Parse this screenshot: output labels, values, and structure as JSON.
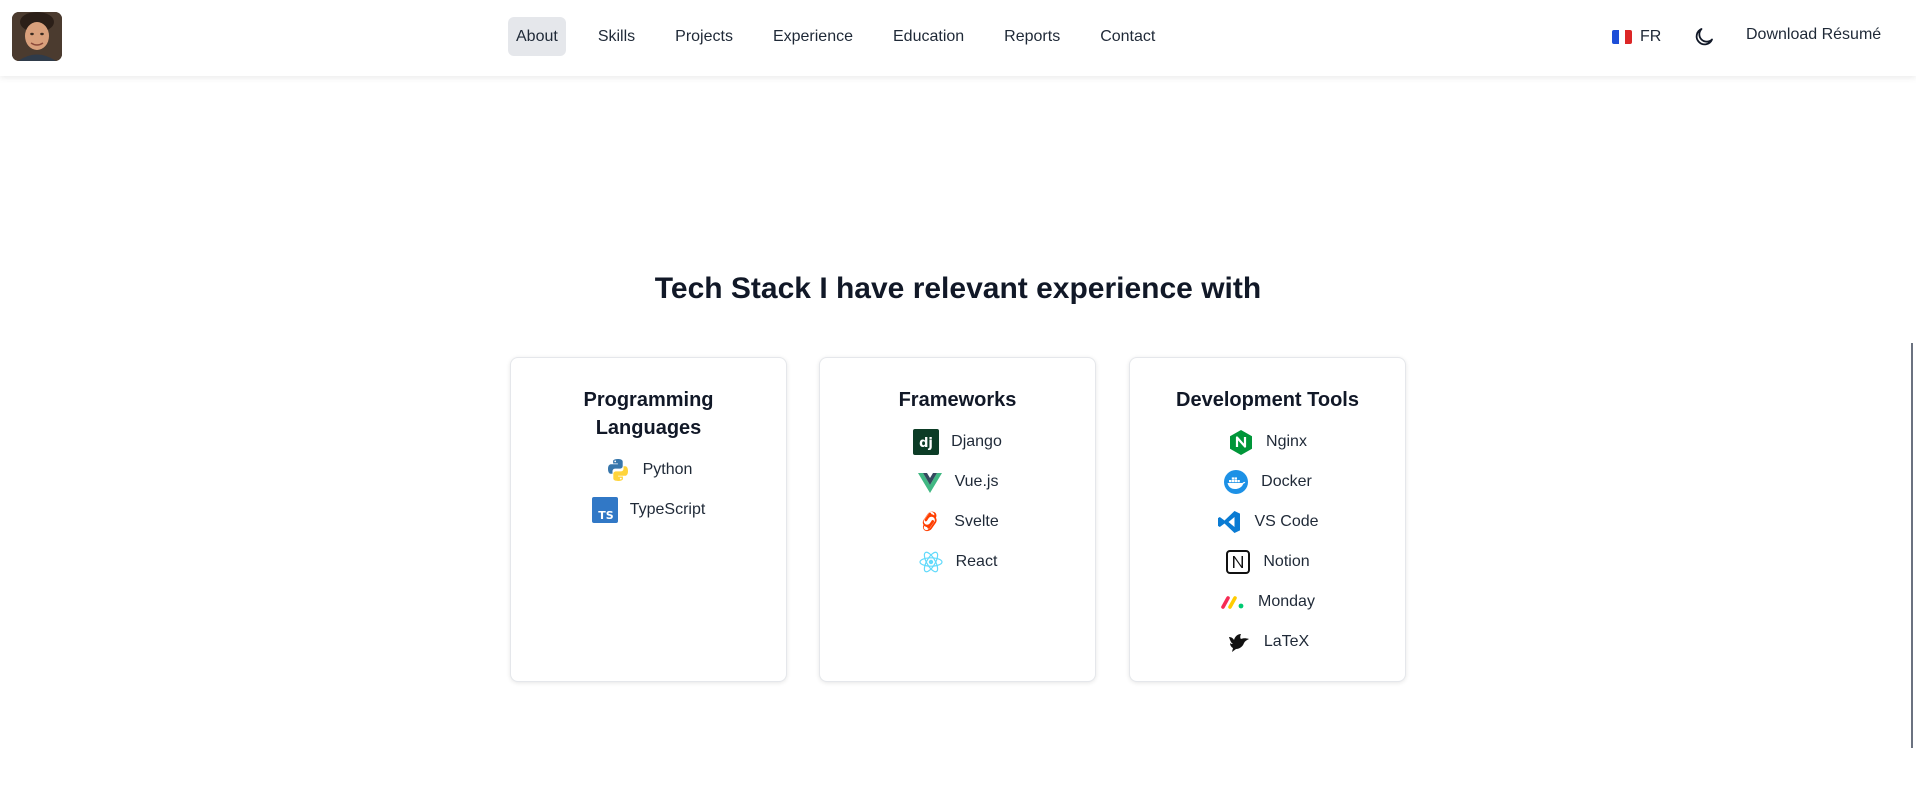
{
  "header": {
    "nav": [
      {
        "label": "About",
        "active": true
      },
      {
        "label": "Skills",
        "active": false
      },
      {
        "label": "Projects",
        "active": false
      },
      {
        "label": "Experience",
        "active": false
      },
      {
        "label": "Education",
        "active": false
      },
      {
        "label": "Reports",
        "active": false
      },
      {
        "label": "Contact",
        "active": false
      }
    ],
    "language": {
      "label": "FR",
      "icon": "france-flag-icon"
    },
    "theme_icon": "moon-icon",
    "download_label": "Download Résumé"
  },
  "section": {
    "title": "Tech Stack I have relevant experience with",
    "cards": [
      {
        "title": "Programming Languages",
        "items": [
          {
            "label": "Python",
            "icon": "python-icon"
          },
          {
            "label": "TypeScript",
            "icon": "typescript-icon"
          }
        ]
      },
      {
        "title": "Frameworks",
        "items": [
          {
            "label": "Django",
            "icon": "django-icon"
          },
          {
            "label": "Vue.js",
            "icon": "vuejs-icon"
          },
          {
            "label": "Svelte",
            "icon": "svelte-icon"
          },
          {
            "label": "React",
            "icon": "react-icon"
          }
        ]
      },
      {
        "title": "Development Tools",
        "items": [
          {
            "label": "Nginx",
            "icon": "nginx-icon"
          },
          {
            "label": "Docker",
            "icon": "docker-icon"
          },
          {
            "label": "VS Code",
            "icon": "vscode-icon"
          },
          {
            "label": "Notion",
            "icon": "notion-icon"
          },
          {
            "label": "Monday",
            "icon": "monday-icon"
          },
          {
            "label": "LaTeX",
            "icon": "latex-icon"
          }
        ]
      }
    ]
  },
  "colors": {
    "active_nav_bg": "#e5e7eb",
    "text": "#111827",
    "card_border": "#e5e7eb"
  }
}
